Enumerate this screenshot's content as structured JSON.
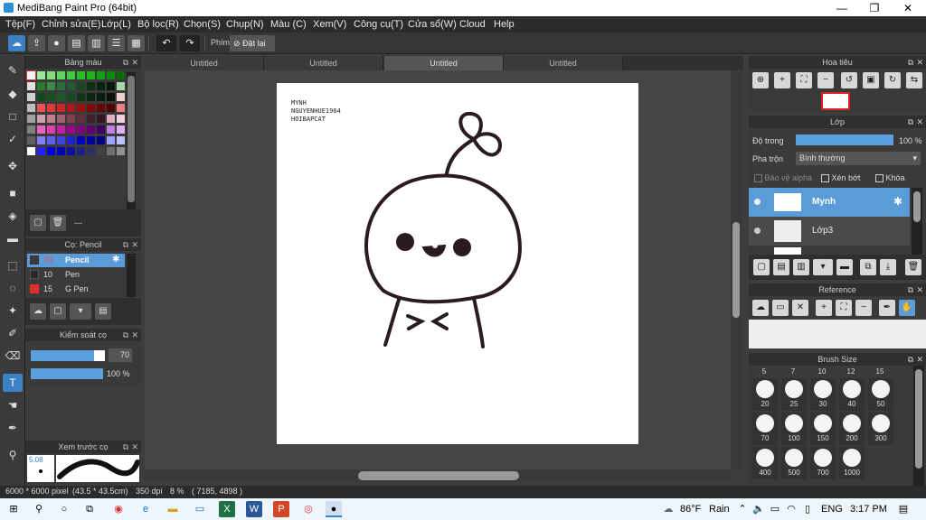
{
  "window": {
    "title": "MediBang Paint Pro (64bit)",
    "minimize": "—",
    "maximize": "❐",
    "close": "✕"
  },
  "menu": [
    "Tệp(F)",
    "Chỉnh sửa(E)",
    "Lớp(L)",
    "Bộ lọc(R)",
    "Chọn(S)",
    "Chụp(N)",
    "Màu (C)",
    "Xem(V)",
    "Công cụ(T)",
    "Cửa sổ(W)",
    "Cloud",
    "Help"
  ],
  "toolbar": {
    "keys_label": "Phím",
    "reset_label": "Đặt lại"
  },
  "panels": {
    "colors": {
      "title": "Bảng màu",
      "footer_value": "---"
    },
    "brush": {
      "title": "Cọ: Pencil",
      "items": [
        {
          "size": "70",
          "name": "Pencil",
          "color": "#3a3a3a"
        },
        {
          "size": "10",
          "name": "Pen",
          "color": "#2a2a2a"
        },
        {
          "size": "15",
          "name": "G Pen",
          "color": "#e03030"
        }
      ]
    },
    "brush_control": {
      "title": "Kiểm soát cọ",
      "size_value": "70",
      "size_fraction": 0.85,
      "opacity_value": "100 %",
      "opacity_fraction": 1.0
    },
    "brush_preview": {
      "title": "Xem trước cọ",
      "size_label": "5.08"
    },
    "navigator": {
      "title": "Hoa tiêu"
    },
    "layer": {
      "title": "Lớp",
      "opacity_label": "Độ trong",
      "opacity_value": "100 %",
      "opacity_fraction": 1.0,
      "blend_label": "Pha trộn",
      "blend_value": "Bình thường",
      "protect_alpha_label": "Bảo vệ alpha",
      "clip_label": "Xén bớt",
      "lock_label": "Khóa",
      "layers": [
        {
          "name": "Mynh",
          "selected": true
        },
        {
          "name": "Lớp3",
          "selected": false
        }
      ]
    },
    "reference": {
      "title": "Reference"
    },
    "brush_size": {
      "title": "Brush Size",
      "top_row": [
        "5",
        "7",
        "10",
        "12",
        "15"
      ],
      "rows": [
        [
          "20",
          "25",
          "30",
          "40",
          "50"
        ],
        [
          "70",
          "100",
          "150",
          "200",
          "300"
        ],
        [
          "400",
          "500",
          "700",
          "1000"
        ]
      ]
    }
  },
  "tabs": [
    "Untitled",
    "Untitled",
    "Untitled",
    "Untitled"
  ],
  "active_tab_index": 2,
  "canvas": {
    "handwriting_lines": [
      "MYNH",
      "NGUYENHUE1964",
      "HOIBAPCAT"
    ]
  },
  "status": {
    "size": "6000 * 6000 pixel",
    "dims": "(43.5 * 43.5cm)",
    "dpi": "350 dpi",
    "zoom": "8 %",
    "coords": "( 7185, 4898 )"
  },
  "taskbar": {
    "temperature": "86°F",
    "weather": "Rain",
    "language": "ENG",
    "time": "3:17 PM"
  },
  "colors": {
    "accent": "#3a82c4",
    "selection": "#5a9bd8",
    "panel_bg": "#3a3a3a",
    "canvas_bg": "#464646"
  }
}
